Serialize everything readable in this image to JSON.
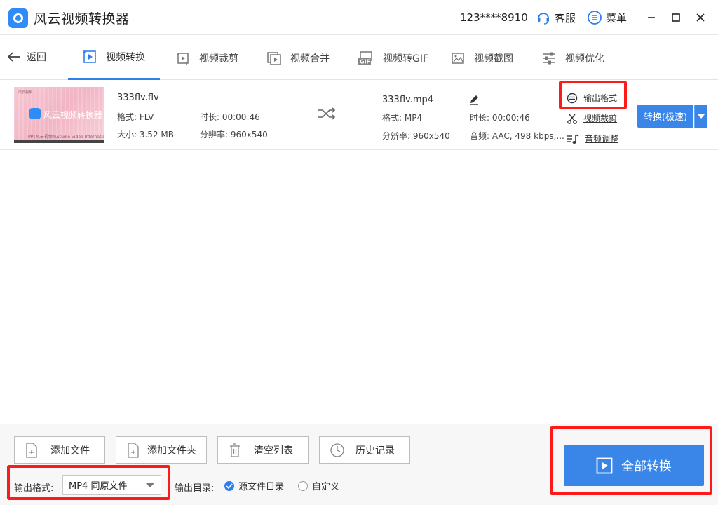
{
  "app": {
    "title": "风云视频转换器"
  },
  "header": {
    "account": "123****8910",
    "service_label": "客服",
    "menu_label": "菜单"
  },
  "toolbar": {
    "back_label": "返回",
    "tabs": [
      {
        "label": "视频转换",
        "icon": "video-convert-icon",
        "active": true
      },
      {
        "label": "视频裁剪",
        "icon": "video-crop-icon"
      },
      {
        "label": "视频合并",
        "icon": "video-merge-icon"
      },
      {
        "label": "视频转GIF",
        "icon": "gif-icon"
      },
      {
        "label": "视频截图",
        "icon": "image-icon"
      },
      {
        "label": "视频优化",
        "icon": "sliders-icon"
      }
    ]
  },
  "file": {
    "thumb_title": "风云视频转换器",
    "thumb_small": "PPT风云视频风Studio Video International",
    "thumb_tag": "风云视频",
    "source": {
      "name": "333flv.flv",
      "format": "格式: FLV",
      "size": "大小: 3.52 MB",
      "duration": "时长: 00:00:46",
      "resolution": "分辨率: 960x540"
    },
    "output": {
      "name": "333flv.mp4",
      "format": "格式: MP4",
      "resolution": "分辨率: 960x540",
      "duration": "时长: 00:00:46",
      "audio": "音频: AAC, 498 kbps,..."
    },
    "options": {
      "output_format": "输出格式",
      "video_crop": "视频裁剪",
      "audio_adjust": "音频调整"
    },
    "convert_label": "转换(极速)"
  },
  "bottom": {
    "add_file": "添加文件",
    "add_folder": "添加文件夹",
    "clear_list": "清空列表",
    "history": "历史记录",
    "output_format_label": "输出格式:",
    "output_format_value": "MP4 同原文件",
    "output_dir_label": "输出目录:",
    "dir_source": "源文件目录",
    "dir_custom": "自定义",
    "convert_all": "全部转换"
  },
  "colors": {
    "accent": "#3a86e8",
    "highlight": "#ff1a1a"
  }
}
